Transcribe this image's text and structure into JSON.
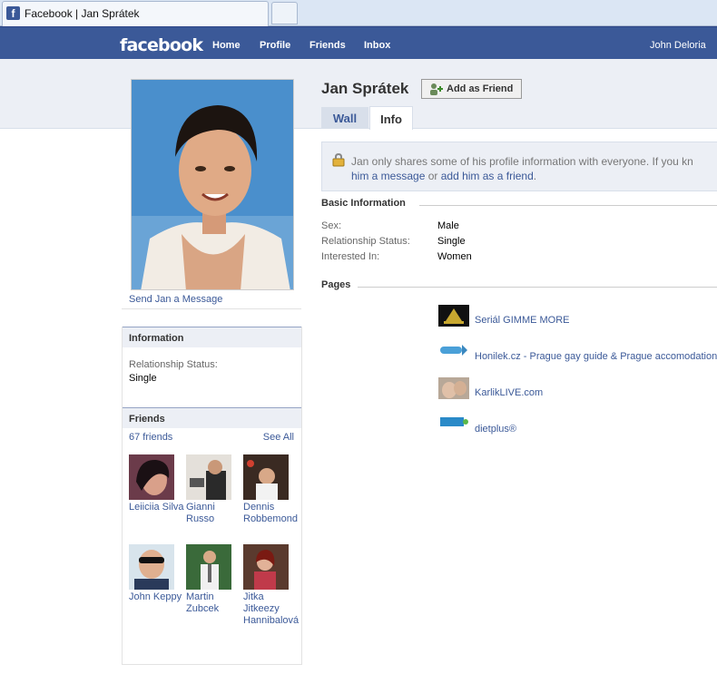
{
  "browser": {
    "tab_title": "Facebook | Jan Sprátek",
    "favicon_letter": "f"
  },
  "topbar": {
    "logo": "facebook",
    "nav": {
      "home": "Home",
      "profile": "Profile",
      "friends": "Friends",
      "inbox": "Inbox"
    },
    "user_name": "John Deloria"
  },
  "profile": {
    "name": "Jan Sprátek",
    "add_friend_label": "Add as Friend",
    "send_message_link": "Send Jan a Message",
    "tabs": {
      "wall": "Wall",
      "info": "Info"
    }
  },
  "notice": {
    "line1": "Jan only shares some of his profile information with everyone. If you kn",
    "message_link": "him a message",
    "or_text": " or ",
    "friend_link": "add him as a friend",
    "period": "."
  },
  "basic_info": {
    "title": "Basic Information",
    "rows": [
      {
        "label": "Sex:",
        "value": "Male"
      },
      {
        "label": "Relationship Status:",
        "value": "Single"
      },
      {
        "label": "Interested In:",
        "value": "Women"
      }
    ]
  },
  "pages": {
    "title": "Pages",
    "items": [
      {
        "name": "Seriál GIMME MORE",
        "icon": "gimme-more-logo"
      },
      {
        "name": "Honilek.cz - Prague gay guide & Prague accomodation",
        "icon": "honilek-logo"
      },
      {
        "name": "KarlikLIVE.com",
        "icon": "karliklive-photo"
      },
      {
        "name": "dietplus®",
        "icon": "dietplus-logo"
      }
    ]
  },
  "sidebar": {
    "information": {
      "title": "Information",
      "label": "Relationship Status:",
      "value": "Single"
    },
    "friends": {
      "title": "Friends",
      "count_label": "67 friends",
      "see_all": "See All",
      "list": [
        {
          "name": "Leiiciia Silva"
        },
        {
          "name": "Gianni Russo"
        },
        {
          "name": "Dennis Robbemond"
        },
        {
          "name": "John Keppy"
        },
        {
          "name": "Martin Zubcek"
        },
        {
          "name": "Jitka Jitkeezy Hannibalová"
        }
      ]
    }
  },
  "colors": {
    "facebook_blue": "#3b5998",
    "header_band": "#eceff5",
    "tab_inactive": "#d8dfea"
  }
}
